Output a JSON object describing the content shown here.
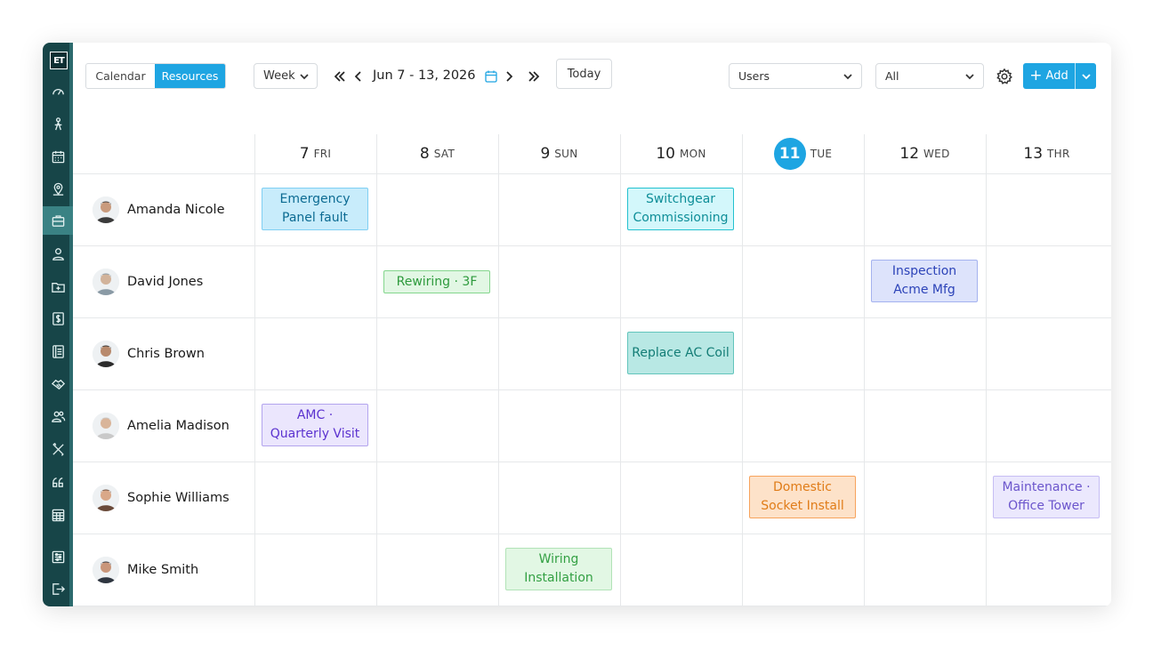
{
  "app": {
    "logo": "ET"
  },
  "sidebar": {
    "icons": [
      "dashboard-icon",
      "person-pin-icon",
      "calendar-icon",
      "map-pin-icon",
      "briefcase-icon",
      "user-icon",
      "folder-plus-icon",
      "dollar-icon",
      "document-icon",
      "handshake-icon",
      "users-icon",
      "tools-icon",
      "quote-icon",
      "spreadsheet-icon",
      "sliders-icon",
      "logout-icon"
    ],
    "active_index": 4
  },
  "toolbar": {
    "view_tabs": [
      "Calendar",
      "Resources"
    ],
    "selected_tab": "Resources",
    "range": "Week",
    "date_range": "Jun 7 - 13, 2026",
    "today_label": "Today",
    "filter_group": "Users",
    "filter_value": "All",
    "add_label": "Add"
  },
  "days": [
    {
      "num": "7",
      "dow": "FRI"
    },
    {
      "num": "8",
      "dow": "SAT"
    },
    {
      "num": "9",
      "dow": "SUN"
    },
    {
      "num": "10",
      "dow": "MON"
    },
    {
      "num": "11",
      "dow": "TUE",
      "today": true
    },
    {
      "num": "12",
      "dow": "WED"
    },
    {
      "num": "13",
      "dow": "THR"
    }
  ],
  "people": [
    "Amanda Nicole",
    "David Jones",
    "Chris Brown",
    "Amelia Madison",
    "Sophie Williams",
    "Mike Smith"
  ],
  "events": [
    {
      "row": 0,
      "day": 0,
      "label": "Emergency Panel fault",
      "bg": "#c8ecfb",
      "border": "#7fcff3",
      "color": "#0b6a92"
    },
    {
      "row": 0,
      "day": 3,
      "label": "Switchgear Commissioning",
      "bg": "#d3f7fb",
      "border": "#23c1cf",
      "color": "#0e8e98"
    },
    {
      "row": 1,
      "day": 1,
      "label": "Rewiring · 3F",
      "bg": "#e2f7e4",
      "border": "#84d68d",
      "color": "#2d9a3c"
    },
    {
      "row": 1,
      "day": 5,
      "label": "Inspection Acme Mfg",
      "bg": "#dde3fb",
      "border": "#a4b2ef",
      "color": "#2c43b8"
    },
    {
      "row": 2,
      "day": 3,
      "label": "Replace AC Coil",
      "bg": "#b8e8e4",
      "border": "#62c5bc",
      "color": "#137d76"
    },
    {
      "row": 3,
      "day": 0,
      "label": "AMC · Quarterly Visit",
      "bg": "#ebe6fd",
      "border": "#b3a4ee",
      "color": "#5b32cf"
    },
    {
      "row": 4,
      "day": 4,
      "label": "Domestic Socket Install",
      "bg": "#fde2c9",
      "border": "#f7a35c",
      "color": "#e07c18"
    },
    {
      "row": 4,
      "day": 6,
      "label": "Maintenance · Office Tower",
      "bg": "#ebe8fd",
      "border": "#c6bdf4",
      "color": "#6b55cc"
    },
    {
      "row": 5,
      "day": 2,
      "label": "Wiring Installation",
      "bg": "#e2f7e4",
      "border": "#b1e3b7",
      "color": "#33a043"
    }
  ],
  "colors": {
    "accent": "#1ea5e2",
    "sidebar": "#174548",
    "sidebar_active": "#3a8284"
  }
}
